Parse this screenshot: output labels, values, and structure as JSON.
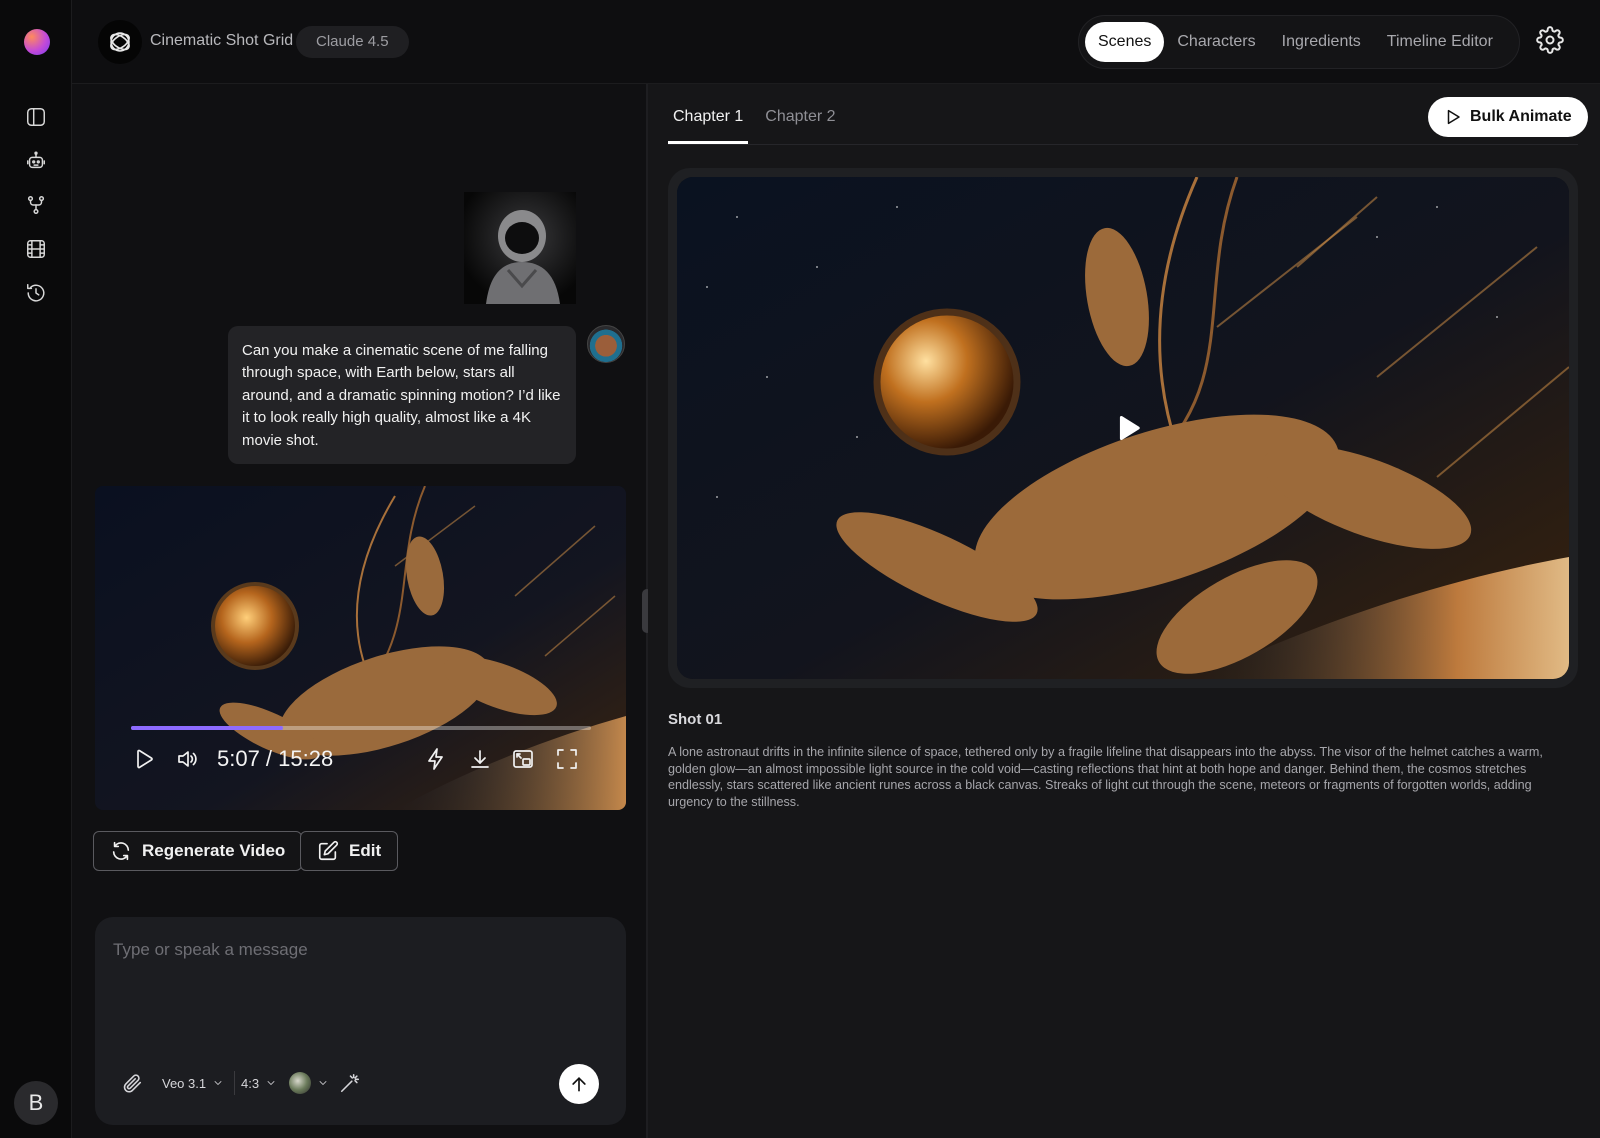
{
  "app": {
    "title": "Cinematic Shot Grid",
    "model": "Claude 4.5",
    "user_initial": "B"
  },
  "nav": {
    "tabs": [
      {
        "label": "Scenes",
        "active": true
      },
      {
        "label": "Characters",
        "active": false
      },
      {
        "label": "Ingredients",
        "active": false
      },
      {
        "label": "Timeline Editor",
        "active": false
      }
    ]
  },
  "sidebar": {
    "icons": [
      "panel-toggle-icon",
      "robot-icon",
      "branch-icon",
      "film-icon",
      "history-icon"
    ]
  },
  "chat": {
    "user_message": "Can you make a cinematic scene of me falling through space, with Earth below, stars all around, and a dramatic spinning motion? I’d like it to look really high quality, almost like a 4K movie shot.",
    "video": {
      "time": "5:07 / 15:28",
      "progress": 0.33
    },
    "actions": {
      "regenerate": "Regenerate Video",
      "edit": "Edit"
    },
    "composer": {
      "placeholder": "Type or speak a message",
      "model": "Veo 3.1",
      "aspect": "4:3"
    }
  },
  "scenes": {
    "chapters": [
      {
        "label": "Chapter 1",
        "active": true
      },
      {
        "label": "Chapter 2",
        "active": false
      }
    ],
    "bulk_animate": "Bulk Animate",
    "shot": {
      "title": "Shot 01",
      "description": "A lone astronaut drifts in the infinite silence of space, tethered only by a fragile lifeline that disappears into the abyss. The visor of the helmet catches a warm, golden glow—an almost impossible light source in the cold void—casting reflections that hint at both hope and danger. Behind them, the cosmos stretches endlessly, stars scattered like ancient runes across a black canvas. Streaks of light cut through the scene, meteors or fragments of forgotten worlds, adding urgency to the stillness."
    }
  },
  "colors": {
    "accent": "#8d6bff",
    "background": "#101012",
    "panel": "#161618"
  }
}
